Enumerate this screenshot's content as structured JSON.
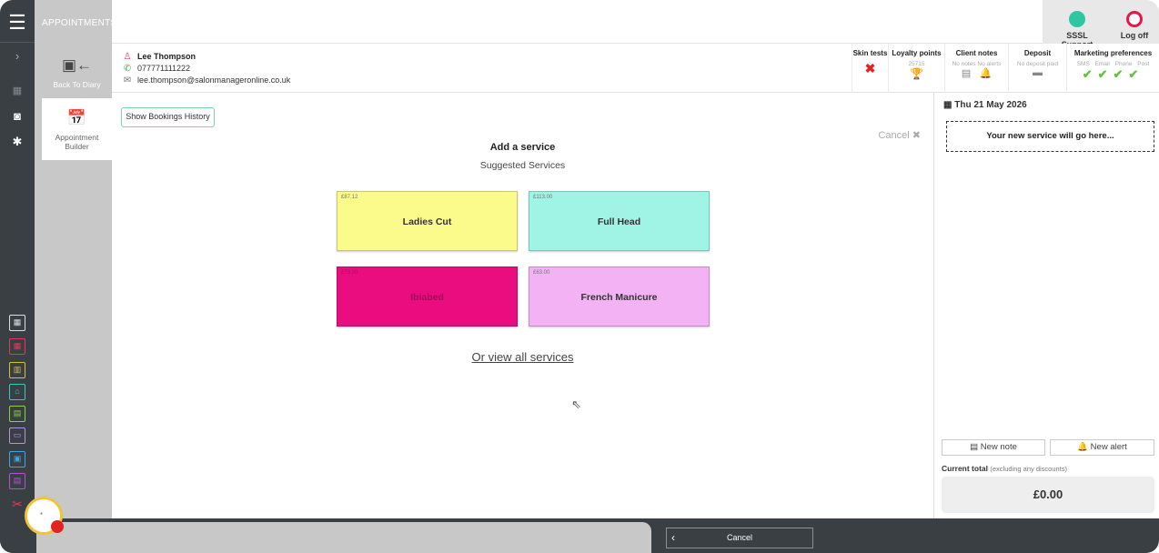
{
  "app": {
    "section_title": "APPOINTMENTS"
  },
  "top_buttons": {
    "support": "SSSL Support",
    "logoff": "Log off"
  },
  "side_tabs": {
    "back": "Back To Diary",
    "builder_line1": "Appointment",
    "builder_line2": "Builder"
  },
  "client": {
    "name": "Lee Thompson",
    "phone": "077771111222",
    "email": "lee.thompson@salonmanageronline.co.uk"
  },
  "client_columns": {
    "skin_tests": "Skin tests",
    "loyalty_points": "Loyalty points",
    "loyalty_value": "25715",
    "client_notes": "Client notes",
    "no_notes": "No notes",
    "no_alerts": "No alerts",
    "deposit": "Deposit",
    "no_deposit": "No deposit paid",
    "marketing": "Marketing preferences",
    "sms": "SMS",
    "email": "Email",
    "phone": "Phone",
    "post": "Post"
  },
  "main": {
    "history_button": "Show Bookings History",
    "cancel": "Cancel ✖",
    "heading": "Add a service",
    "subheading": "Suggested Services",
    "view_all": "Or view all services"
  },
  "services": [
    {
      "name": "Ladies Cut",
      "price": "£87.12",
      "color": "#fbfb8c"
    },
    {
      "name": "Full Head",
      "price": "£113.00",
      "color": "#9ff4e6"
    },
    {
      "name": "Ibiabed",
      "price": "£73.00",
      "color": "#ea0d7f"
    },
    {
      "name": "French Manicure",
      "price": "£63.00",
      "color": "#f2b2f4"
    }
  ],
  "right_panel": {
    "date": "Thu 21 May 2026",
    "placeholder": "Your new service will go here...",
    "new_note": "New note",
    "new_alert": "New alert",
    "total_label": "Current total",
    "total_note": "(excluding any discounts)",
    "total_value": "£0.00"
  },
  "bottom": {
    "cancel": "Cancel"
  },
  "colors": {
    "dark": "#3a3f44",
    "gray": "#c8c8c8",
    "check": "#6abf40",
    "danger": "#e02424",
    "support": "#2fc7a1",
    "logoff": "#e8164b"
  }
}
